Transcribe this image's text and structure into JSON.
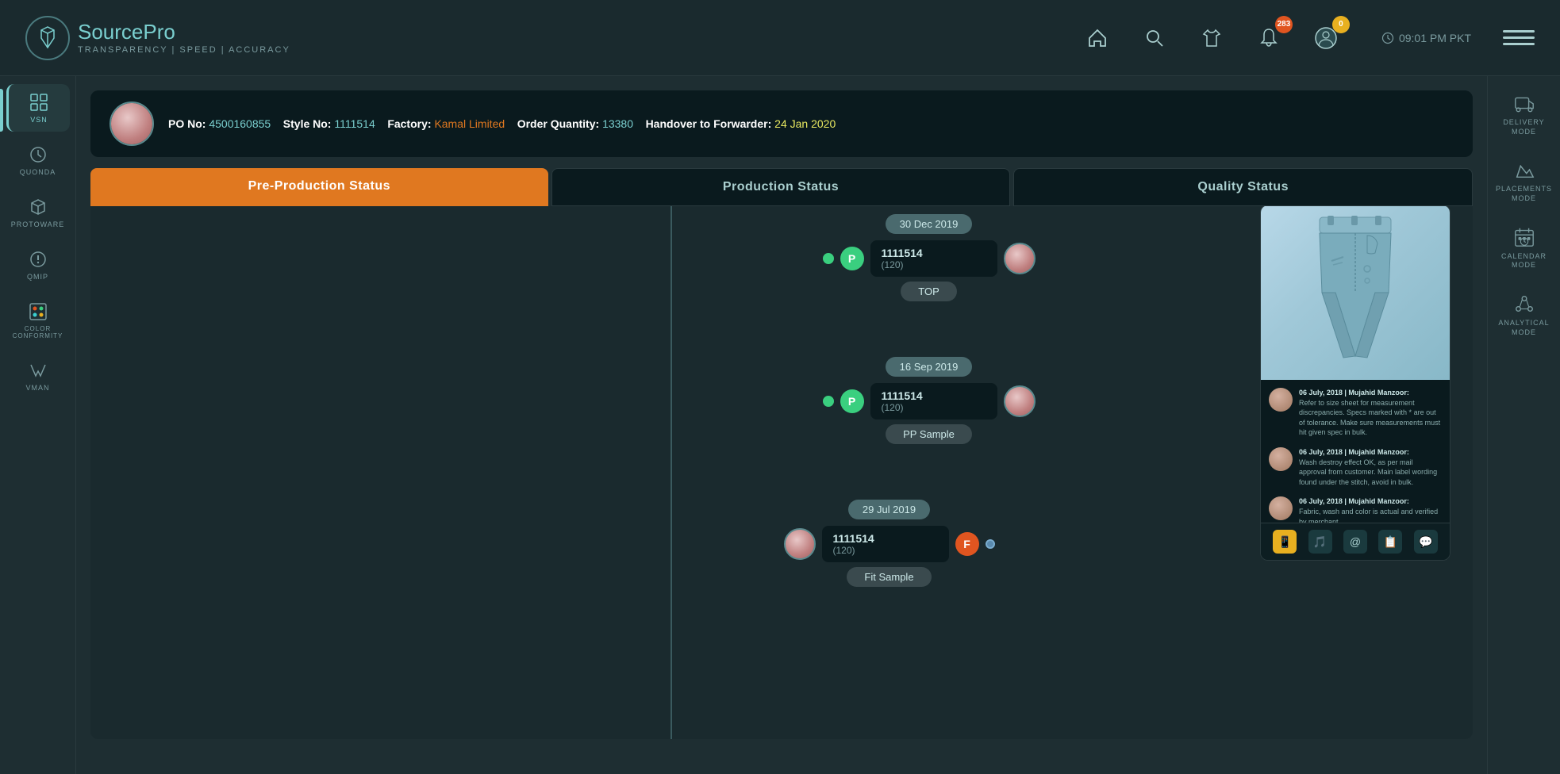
{
  "app": {
    "title": "SourcePro",
    "title_part1": "Source",
    "title_part2": "Pro",
    "subtitle": "TRANSPARENCY  |  SPEED  |  ACCURACY",
    "time": "09:01 PM PKT"
  },
  "nav": {
    "home_label": "home",
    "search_label": "search",
    "shirt_label": "shirt",
    "bell_label": "bell",
    "bell_badge": "283",
    "user_label": "user",
    "user_badge": "0"
  },
  "sidebar": {
    "items": [
      {
        "id": "vsn",
        "label": "VSN",
        "active": true
      },
      {
        "id": "quonda",
        "label": "QUONDA",
        "active": false
      },
      {
        "id": "protoware",
        "label": "PROTOWARE",
        "active": false
      },
      {
        "id": "qmip",
        "label": "QMIP",
        "active": false
      },
      {
        "id": "color-conformity",
        "label": "COLOR CONFORMITY",
        "active": false
      },
      {
        "id": "vman",
        "label": "VMAN",
        "active": false
      }
    ]
  },
  "right_sidebar": {
    "items": [
      {
        "id": "delivery-mode",
        "label": "DELIVERY MODE"
      },
      {
        "id": "placements-mode",
        "label": "PLACEMENTS MODE"
      },
      {
        "id": "calendar-mode",
        "label": "CALENDAR MODE"
      },
      {
        "id": "analytical-mode",
        "label": "ANALYTICAL MODE"
      }
    ]
  },
  "po": {
    "label_po": "PO No:",
    "po_number": "4500160855",
    "label_style": "Style No:",
    "style_number": "1111514",
    "label_factory": "Factory:",
    "factory_name": "Kamal Limited",
    "label_qty": "Order Quantity:",
    "quantity": "13380",
    "label_handover": "Handover to Forwarder:",
    "handover_date": "24 Jan 2020"
  },
  "tabs": {
    "tab1": "Pre-Production Status",
    "tab2": "Production Status",
    "tab3": "Quality Status"
  },
  "timeline": {
    "nodes": [
      {
        "date": "30 Dec 2019",
        "style": "1111514",
        "qty": "(120)",
        "label": "TOP",
        "badge_type": "P",
        "badge_color": "green"
      },
      {
        "date": "16 Sep 2019",
        "style": "1111514",
        "qty": "(120)",
        "label": "PP Sample",
        "badge_type": "P",
        "badge_color": "green"
      },
      {
        "date": "29 Jul 2019",
        "style": "1111514",
        "qty": "(120)",
        "label": "Fit Sample",
        "badge_type": "F",
        "badge_color": "orange"
      }
    ]
  },
  "quality": {
    "title": "Quality Status",
    "comments": [
      {
        "author": "06 July, 2018 | Mujahid Manzoor:",
        "text": "Refer to size sheet for measurement discrepancies. Specs marked with * are out of tolerance. Make sure measurements must hit given spec in bulk."
      },
      {
        "author": "06 July, 2018 | Mujahid Manzoor:",
        "text": "Wash destroy effect OK, as per mail approval from customer. Main label wording found under the stitch, avoid in bulk."
      },
      {
        "author": "06 July, 2018 | Mujahid Manzoor:",
        "text": "Fabric, wash and color is actual and verified by merchant."
      }
    ],
    "actions": [
      "📱",
      "🎵",
      "@",
      "📋",
      "💬"
    ]
  }
}
